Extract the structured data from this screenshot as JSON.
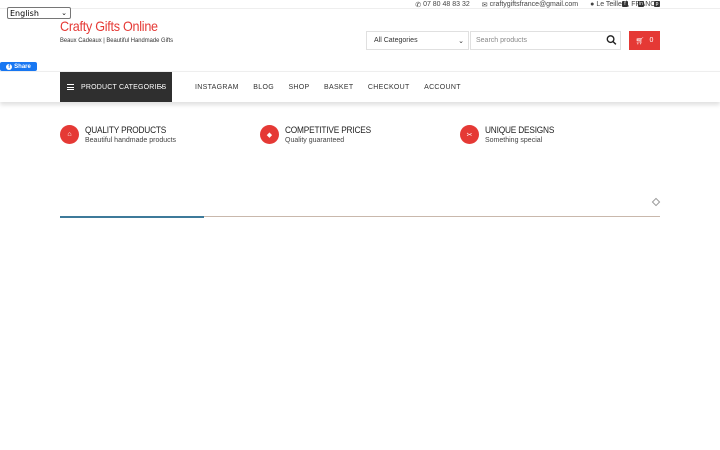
{
  "language": {
    "selected": "English"
  },
  "topbar": {
    "phone": "07 80 48 83 32",
    "email": "craftygiftsfrance@gmail.com",
    "location": "Le Teilleul, FRANCE",
    "social_icons": [
      "facebook-icon",
      "linkedin-icon",
      "pinterest-icon"
    ]
  },
  "header": {
    "site_title": "Crafty Gifts Online",
    "tagline": "Beaux Cadeaux | Beautiful Handmade Gifts"
  },
  "search": {
    "category_selected": "All Categories",
    "placeholder": "Search products"
  },
  "cart": {
    "count": "0"
  },
  "share": {
    "label": "Share"
  },
  "nav": {
    "categories_label": "PRODUCT CATEGORIES",
    "items": [
      "INSTAGRAM",
      "BLOG",
      "SHOP",
      "BASKET",
      "CHECKOUT",
      "ACCOUNT"
    ]
  },
  "features": [
    {
      "title": "QUALITY PRODUCTS",
      "subtitle": "Beautiful handmade products",
      "icon": "home-icon"
    },
    {
      "title": "COMPETITIVE PRICES",
      "subtitle": "Quality guaranteed",
      "icon": "tags-icon"
    },
    {
      "title": "UNIQUE DESIGNS",
      "subtitle": "Something special",
      "icon": "scissors-icon"
    }
  ],
  "slider": {
    "progress": 0.24
  },
  "colors": {
    "accent": "#e53935",
    "nav_dark": "#2f2f2f",
    "progress": "#3d7a9a",
    "facebook": "#1877f2"
  }
}
